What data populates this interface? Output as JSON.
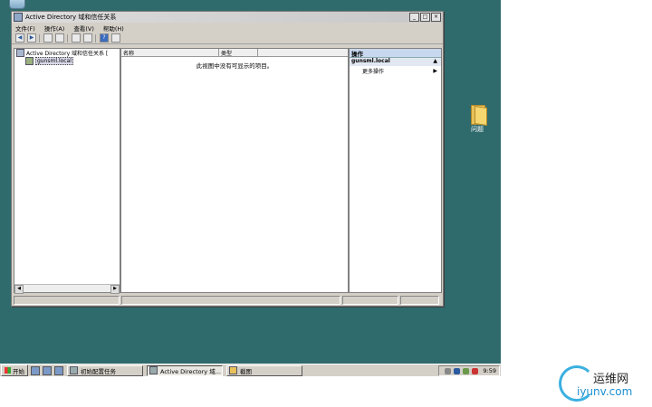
{
  "window": {
    "title": "Active Directory 域和信任关系",
    "min": "_",
    "max": "□",
    "close": "×"
  },
  "menu": [
    "文件(F)",
    "操作(A)",
    "查看(V)",
    "帮助(H)"
  ],
  "toolbar": {
    "back": "◀",
    "forward": "▶",
    "help": "?"
  },
  "tree": {
    "root": "Active Directory 域和信任关系 [",
    "child": "gunsml.local"
  },
  "list": {
    "col_name": "名称",
    "col_type": "类型",
    "empty_message": "此视图中没有可显示的项目。"
  },
  "actions": {
    "header": "操作",
    "section": "gunsml.local",
    "section_arrow": "▲",
    "item": "更多操作",
    "item_arrow": "▶"
  },
  "desktop": {
    "folder_label": "问题"
  },
  "taskbar": {
    "start": "开始",
    "tasks": [
      "初始配置任务",
      "Active Directory 域...",
      "截图"
    ],
    "clock": "9:59"
  },
  "watermark": {
    "cn": "运维网",
    "en": "iyunv.com"
  }
}
